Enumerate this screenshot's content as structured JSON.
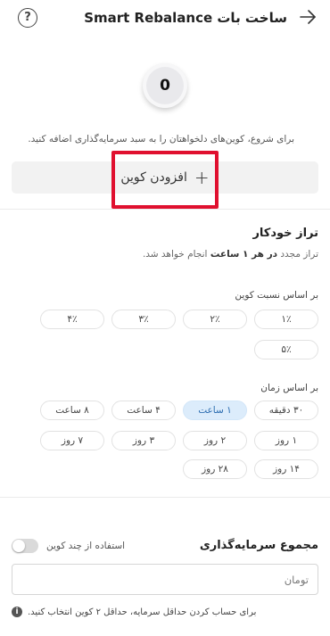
{
  "header": {
    "title": "ساخت بات Smart Rebalance",
    "back_icon": "arrow-right-icon",
    "help_icon": "question-circle-icon",
    "help_glyph": "?"
  },
  "coins": {
    "count": "0",
    "hint": "برای شروع، کوین‌های دلخواهتان را به سبد سرمایه‌گذاری اضافه کنید.",
    "add_label": "افزودن کوین",
    "add_glyph": "+"
  },
  "auto_balance": {
    "title": "تراز خودکار",
    "desc_prefix": "تراز مجدد",
    "desc_highlight": "در هر ۱ ساعت",
    "desc_suffix": "انجام خواهد شد.",
    "ratio_label": "بر اساس نسبت کوین",
    "ratio_options": [
      "۱٪",
      "۲٪",
      "۳٪",
      "۴٪",
      "۵٪"
    ],
    "time_label": "بر اساس زمان",
    "time_options": [
      "۳۰ دقیقه",
      "۱ ساعت",
      "۴ ساعت",
      "۸ ساعت",
      "۱ روز",
      "۲ روز",
      "۳ روز",
      "۷ روز",
      "۱۴ روز",
      "۲۸ روز"
    ],
    "time_selected": "۱ ساعت"
  },
  "investment": {
    "title": "مجموع سرمایه‌گذاری",
    "multi_coin_label": "استفاده از چند کوین",
    "multi_coin_enabled": false,
    "amount_placeholder": "تومان",
    "note": "برای حساب کردن حداقل سرمایه، حداقل ۲ کوین انتخاب کنید.",
    "info_glyph": "i"
  },
  "colors": {
    "accent": "#2b6cb0",
    "chip_active_bg": "#dcecfb",
    "highlight_border": "#e0102f"
  }
}
